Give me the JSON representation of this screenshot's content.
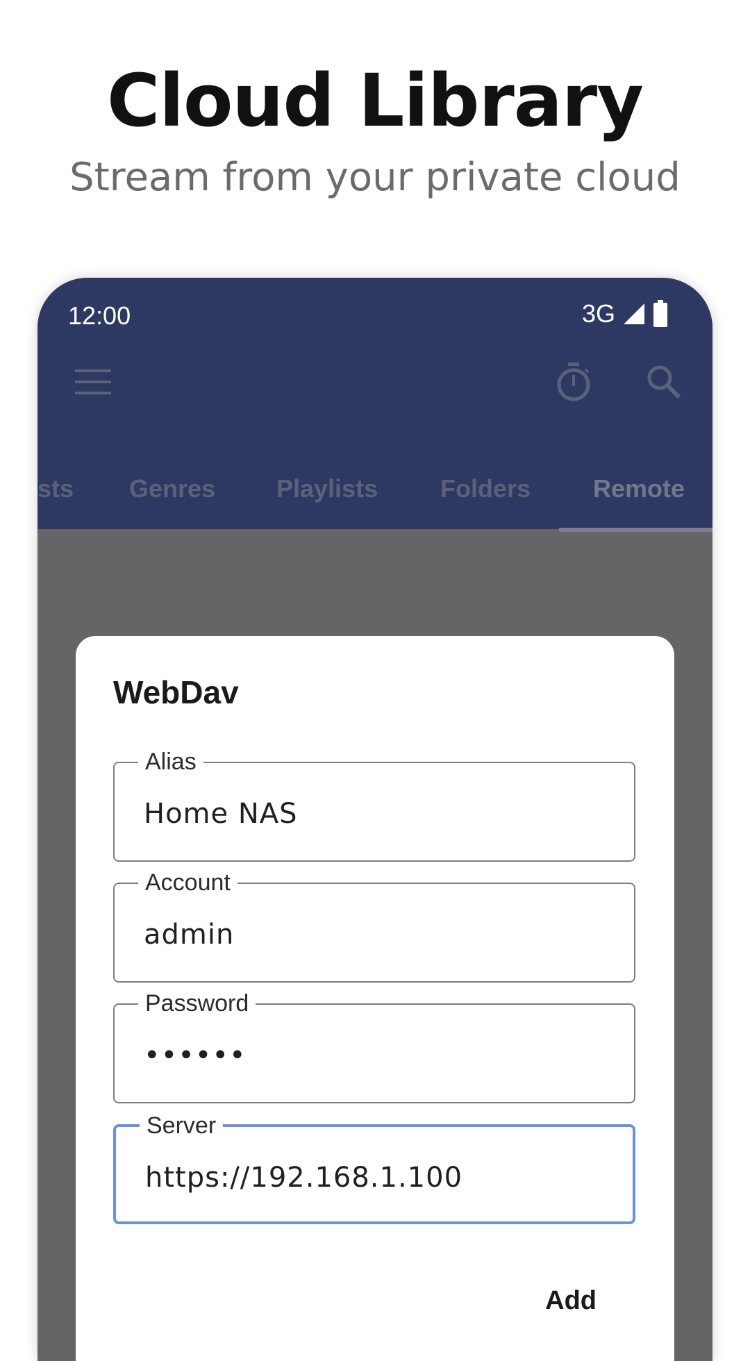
{
  "promo": {
    "title": "Cloud Library",
    "subtitle": "Stream from your private cloud"
  },
  "status_bar": {
    "time": "12:00",
    "network": "3G",
    "icons": [
      "signal-icon",
      "battery-icon"
    ]
  },
  "toolbar": {
    "icons": [
      "menu-icon",
      "timer-icon",
      "search-icon"
    ]
  },
  "tabs": [
    {
      "label": "sts",
      "active": false
    },
    {
      "label": "Genres",
      "active": false
    },
    {
      "label": "Playlists",
      "active": false
    },
    {
      "label": "Folders",
      "active": false
    },
    {
      "label": "Remote",
      "active": true
    }
  ],
  "dialog": {
    "title": "WebDav",
    "fields": [
      {
        "label": "Alias",
        "value": "Home NAS",
        "focused": false
      },
      {
        "label": "Account",
        "value": "admin",
        "focused": false
      },
      {
        "label": "Password",
        "value": "••••••",
        "focused": false
      },
      {
        "label": "Server",
        "value": "https://192.168.1.100",
        "focused": true
      }
    ],
    "add_label": "Add"
  },
  "colors": {
    "app_bar": "#2d3962",
    "scrim": "#656565",
    "focus_border": "#6d8ee6"
  }
}
